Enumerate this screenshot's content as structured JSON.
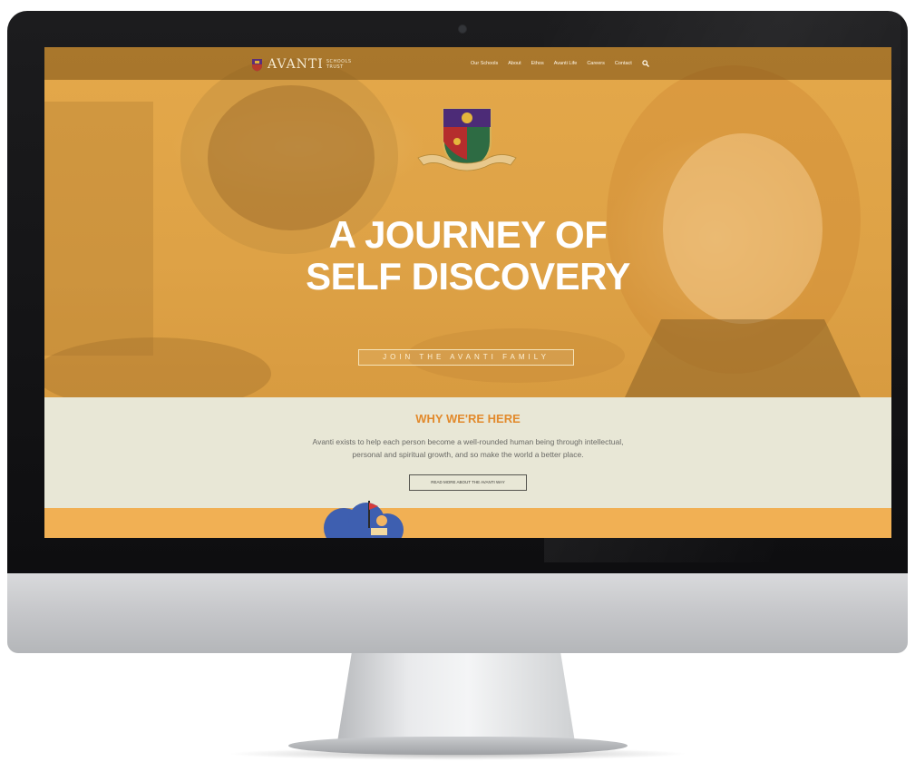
{
  "header": {
    "logo_text": "AVANTI",
    "logo_sub_1": "SCHOOLS",
    "logo_sub_2": "TRUST",
    "nav": [
      "Our Schools",
      "About",
      "Ethos",
      "Avanti Life",
      "Careers",
      "Contact"
    ]
  },
  "hero": {
    "headline_line1": "A JOURNEY OF",
    "headline_line2": "SELF DISCOVERY",
    "cta_label": "JOIN THE AVANTI FAMILY"
  },
  "why": {
    "title": "WHY WE'RE HERE",
    "body_line1": "Avanti exists to help each person become a well-rounded human being through intellectual,",
    "body_line2": "personal and spiritual growth, and so make the world a better place.",
    "button_label": "READ MORE ABOUT THE AVANTI WAY"
  },
  "colors": {
    "hero_orange": "#e2a54a",
    "accent_orange": "#e28a2c",
    "cream": "#e8e7d6",
    "band_orange": "#f1b054"
  },
  "icons": {
    "search": "search-icon",
    "crest": "crest-icon",
    "logo_shield": "shield-icon"
  }
}
